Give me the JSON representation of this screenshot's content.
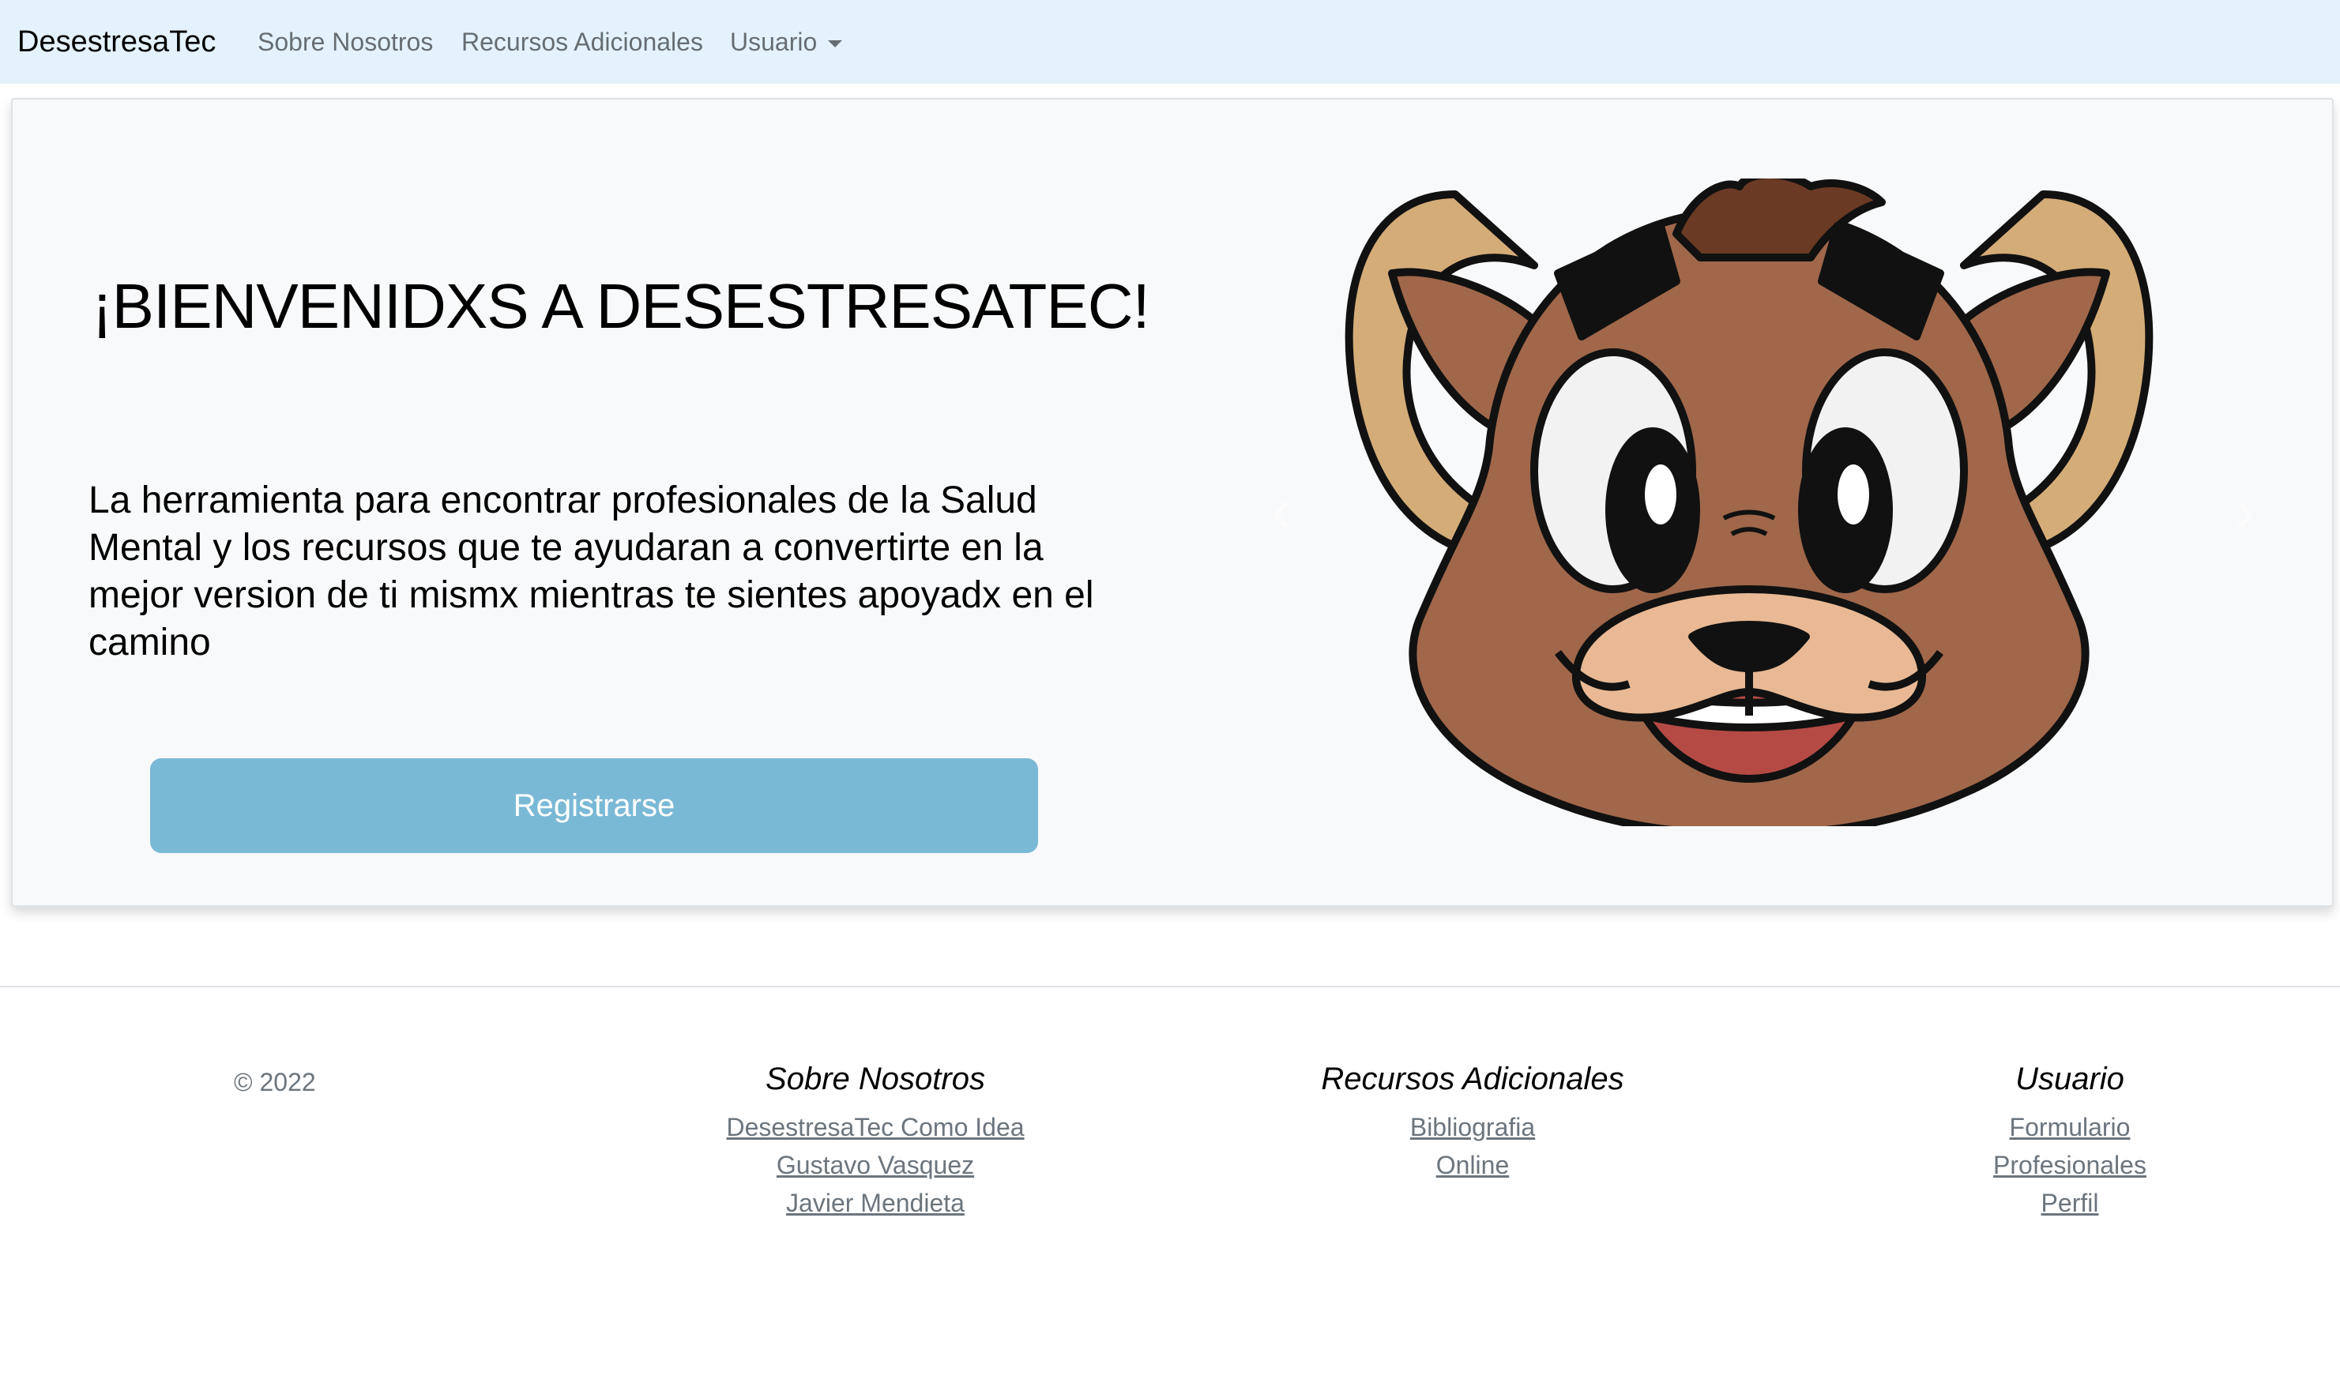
{
  "navbar": {
    "brand": "DesestresaTec",
    "links": [
      "Sobre Nosotros",
      "Recursos Adicionales",
      "Usuario"
    ]
  },
  "hero": {
    "title": "¡BIENVENIDXS A DESESTRESATEC!",
    "text": "La herramienta para encontrar profesionales de la Salud Mental y los recursos que te ayudaran a convertirte en la mejor version de ti mismx mientras te sientes apoyadx en el camino",
    "button": "Registrarse",
    "carousel": {
      "image": "ram-mascot-cartoon",
      "prev_icon": "chevron-left-icon",
      "next_icon": "chevron-right-icon"
    }
  },
  "footer": {
    "copyright": "© 2022",
    "columns": [
      {
        "title": "Sobre Nosotros",
        "links": [
          "DesestresaTec Como Idea",
          "Gustavo Vasquez",
          "Javier Mendieta"
        ]
      },
      {
        "title": "Recursos Adicionales",
        "links": [
          "Bibliografia",
          "Online"
        ]
      },
      {
        "title": "Usuario",
        "links": [
          "Formulario",
          "Profesionales",
          "Perfil"
        ]
      }
    ]
  },
  "colors": {
    "navbar_bg": "#e3f2fd",
    "hero_bg": "#f8f9fa",
    "button_bg": "#7ab9d6",
    "link_muted": "#6c757d"
  }
}
